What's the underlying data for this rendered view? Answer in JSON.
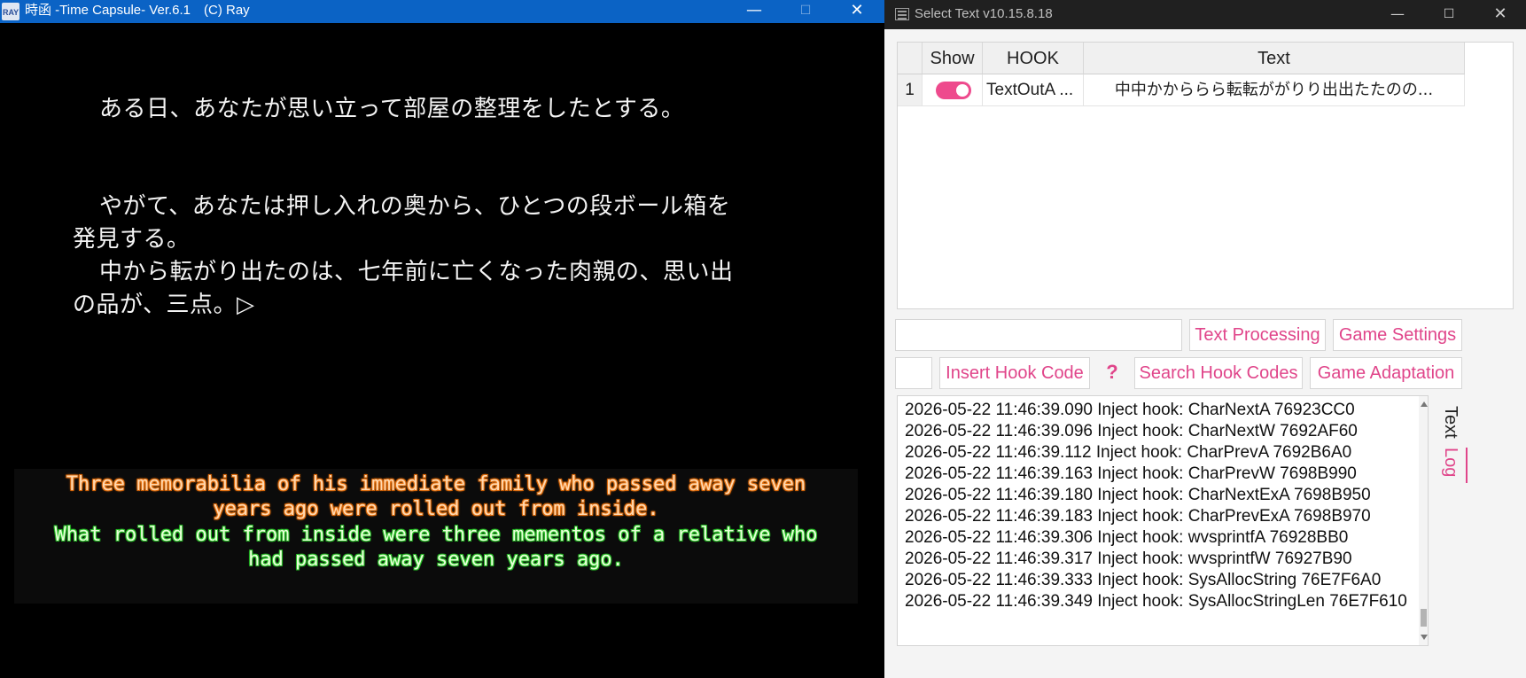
{
  "game_window": {
    "title": "時函 -Time Capsule- Ver.6.1　(C) Ray",
    "app_icon_label": "RAY",
    "controls": {
      "minimize": "—",
      "maximize": "☐",
      "close": "✕"
    },
    "novel_lines": [
      "ある日、あなたが思い立って部屋の整理をしたとする。",
      "やがて、あなたは押し入れの奥から、ひとつの段ボール箱を",
      "発見する。",
      "中から転がり出たのは、七年前に亡くなった肉親の、思い出",
      "の品が、三点。▷"
    ],
    "subtitles": {
      "orange": [
        "Three memorabilia of his immediate family who passed away seven",
        "years ago were rolled out from inside."
      ],
      "green": [
        "What rolled out from inside were three mementos of a relative who",
        "had passed away seven years ago."
      ]
    },
    "colors": {
      "titlebar": "#0b63c5",
      "subtitle_orange": "#ff8a2a",
      "subtitle_green": "#38e038"
    }
  },
  "tool_window": {
    "title": "Select Text v10.15.8.18",
    "controls": {
      "minimize": "—",
      "maximize": "☐",
      "close": "✕"
    },
    "table": {
      "headers": {
        "show": "Show",
        "hook": "HOOK",
        "text": "Text"
      },
      "rows": [
        {
          "index": "1",
          "show": true,
          "hook": "TextOutA ...",
          "text": "中中かかららら転転ががりり出出たたのの..."
        }
      ]
    },
    "buttons": {
      "text_processing": "Text Processing",
      "game_settings": "Game Settings",
      "insert_hook_code": "Insert Hook Code",
      "help": "?",
      "search_hook_codes": "Search Hook Codes",
      "game_adaptation": "Game Adaptation"
    },
    "log_lines": [
      "2026-05-22 11:46:39.090 Inject hook: CharNextA 76923CC0",
      "2026-05-22 11:46:39.096 Inject hook: CharNextW 7692AF60",
      "2026-05-22 11:46:39.112 Inject hook: CharPrevA 7692B6A0",
      "2026-05-22 11:46:39.163 Inject hook: CharPrevW 7698B990",
      "2026-05-22 11:46:39.180 Inject hook: CharNextExA 7698B950",
      "2026-05-22 11:46:39.183 Inject hook: CharPrevExA 7698B970",
      "2026-05-22 11:46:39.306 Inject hook: wvsprintfA 76928BB0",
      "2026-05-22 11:46:39.317 Inject hook: wvsprintfW 76927B90",
      "2026-05-22 11:46:39.333 Inject hook: SysAllocString 76E7F6A0",
      "2026-05-22 11:46:39.349 Inject hook: SysAllocStringLen 76E7F610"
    ],
    "side_tabs": {
      "text": "Text",
      "log": "Log",
      "active": "Log"
    },
    "colors": {
      "accent": "#e0458a",
      "toggle_on": "#ee4a8d",
      "titlebar": "#202020"
    }
  }
}
